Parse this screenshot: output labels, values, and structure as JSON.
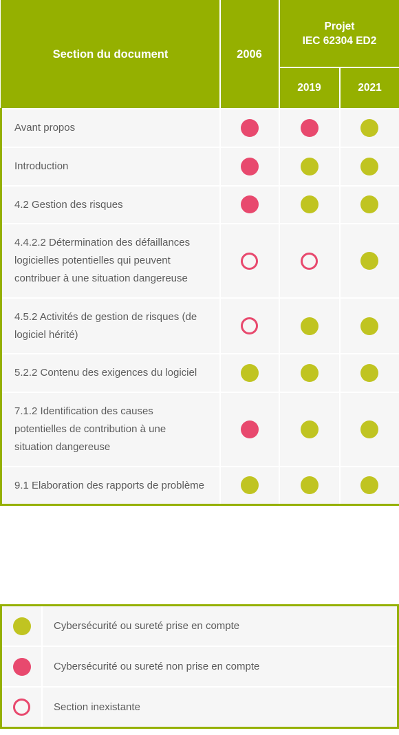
{
  "table": {
    "headers": {
      "section": "Section du document",
      "year_2006": "2006",
      "projet_line1": "Projet",
      "projet_line2": "IEC 62304 ED2",
      "year_2019": "2019",
      "year_2021": "2021"
    },
    "rows": [
      {
        "section": "Avant propos",
        "2006": "pink",
        "2019": "pink",
        "2021": "green"
      },
      {
        "section": "Introduction",
        "2006": "pink",
        "2019": "green",
        "2021": "green"
      },
      {
        "section": "4.2 Gestion des risques",
        "2006": "pink",
        "2019": "green",
        "2021": "green"
      },
      {
        "section": "4.4.2.2 Détermination des défaillances logicielles potentielles qui peuvent contribuer à une situation dangereuse",
        "2006": "empty",
        "2019": "empty",
        "2021": "green"
      },
      {
        "section": "4.5.2 Activités de gestion de risques (de logiciel hérité)",
        "2006": "empty",
        "2019": "green",
        "2021": "green"
      },
      {
        "section": "5.2.2 Contenu des exigences du logiciel",
        "2006": "green",
        "2019": "green",
        "2021": "green"
      },
      {
        "section": "7.1.2 Identification des causes potentielles de contribution à une situation dangereuse",
        "2006": "pink",
        "2019": "green",
        "2021": "green"
      },
      {
        "section": "9.1 Elaboration des rapports de problème",
        "2006": "green",
        "2019": "green",
        "2021": "green"
      }
    ]
  },
  "legend": {
    "items": [
      {
        "marker": "green",
        "label": "Cybersécurité ou sureté prise en compte"
      },
      {
        "marker": "pink",
        "label": "Cybersécurité ou sureté non prise en compte"
      },
      {
        "marker": "empty",
        "label": "Section inexistante"
      }
    ]
  },
  "colors": {
    "header_green": "#95b000",
    "marker_green": "#c0c421",
    "marker_pink": "#e8496e",
    "row_background": "#f6f6f6",
    "text": "#5c5c5c"
  }
}
